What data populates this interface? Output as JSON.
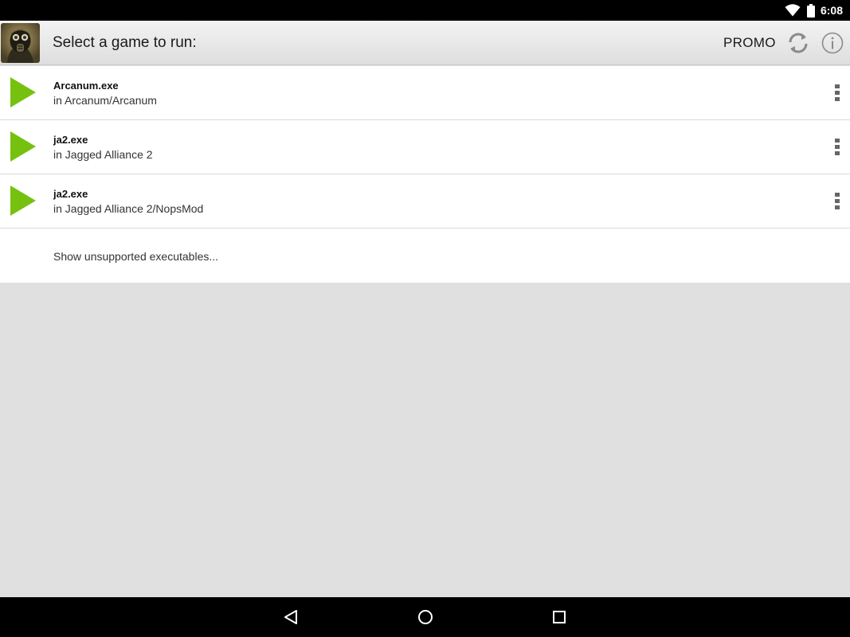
{
  "status_bar": {
    "time": "6:08",
    "icons": [
      "wifi-icon",
      "battery-icon"
    ]
  },
  "action_bar": {
    "title": "Select a game to run:",
    "promo_label": "PROMO",
    "icons": [
      "app-avatar",
      "refresh-icon",
      "info-icon"
    ]
  },
  "games": [
    {
      "name": "Arcanum.exe",
      "path": "in Arcanum/Arcanum"
    },
    {
      "name": "ja2.exe",
      "path": "in Jagged Alliance 2"
    },
    {
      "name": "ja2.exe",
      "path": "in Jagged Alliance 2/NopsMod"
    }
  ],
  "show_unsupported": "Show unsupported executables...",
  "colors": {
    "play_green": "#76c110",
    "status_bar_bg": "#000000",
    "list_bg": "#ffffff",
    "empty_bg": "#e0e0e0"
  },
  "nav_bar": {
    "icons": [
      "back-icon",
      "home-icon",
      "recents-icon"
    ]
  }
}
